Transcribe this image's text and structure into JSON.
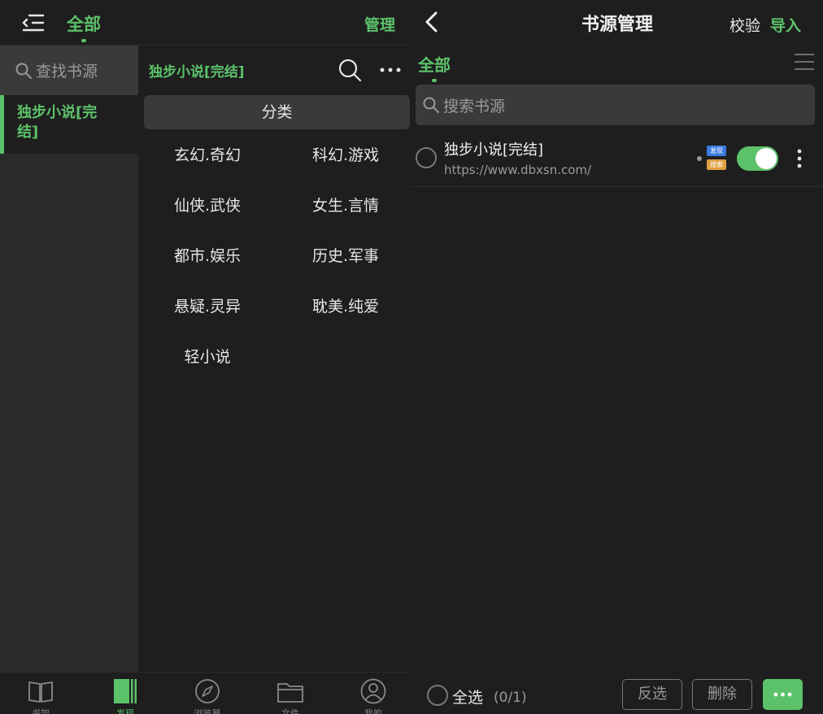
{
  "colors": {
    "accent": "#5cc26a",
    "background": "#1e1e1e",
    "sidebar": "#2a2a2a",
    "field": "#3a3a3a",
    "badge_discover": "#3b7be0",
    "badge_search": "#e0a040"
  },
  "left": {
    "header": {
      "menu_icon": "menu-collapse-icon",
      "tab_all": "全部",
      "manage": "管理"
    },
    "sidebar": {
      "search_placeholder": "查找书源",
      "items": [
        {
          "label": "独步小说[完结]",
          "selected": true
        }
      ]
    },
    "main": {
      "source_title": "独步小说[完结]",
      "category_header": "分类",
      "categories": [
        "玄幻.奇幻",
        "科幻.游戏",
        "仙侠.武侠",
        "女生.言情",
        "都市.娱乐",
        "历史.军事",
        "悬疑.灵异",
        "耽美.纯爱",
        "轻小说"
      ]
    },
    "bottom_nav": [
      {
        "label": "书架",
        "icon": "book-icon",
        "active": false
      },
      {
        "label": "发现",
        "icon": "discover-icon",
        "active": true
      },
      {
        "label": "浏览器",
        "icon": "compass-icon",
        "active": false
      },
      {
        "label": "文件",
        "icon": "folder-icon",
        "active": false
      },
      {
        "label": "我的",
        "icon": "user-icon",
        "active": false
      }
    ]
  },
  "right": {
    "header": {
      "title": "书源管理",
      "verify": "校验",
      "import": "导入"
    },
    "tab_all": "全部",
    "search_placeholder": "搜索书源",
    "sources": [
      {
        "name": "独步小说[完结]",
        "url": "https://www.dbxsn.com/",
        "badges": [
          "发现",
          "搜索"
        ],
        "enabled": true
      }
    ],
    "bottom": {
      "select_all": "全选",
      "count": "(0/1)",
      "invert": "反选",
      "delete": "删除"
    }
  }
}
